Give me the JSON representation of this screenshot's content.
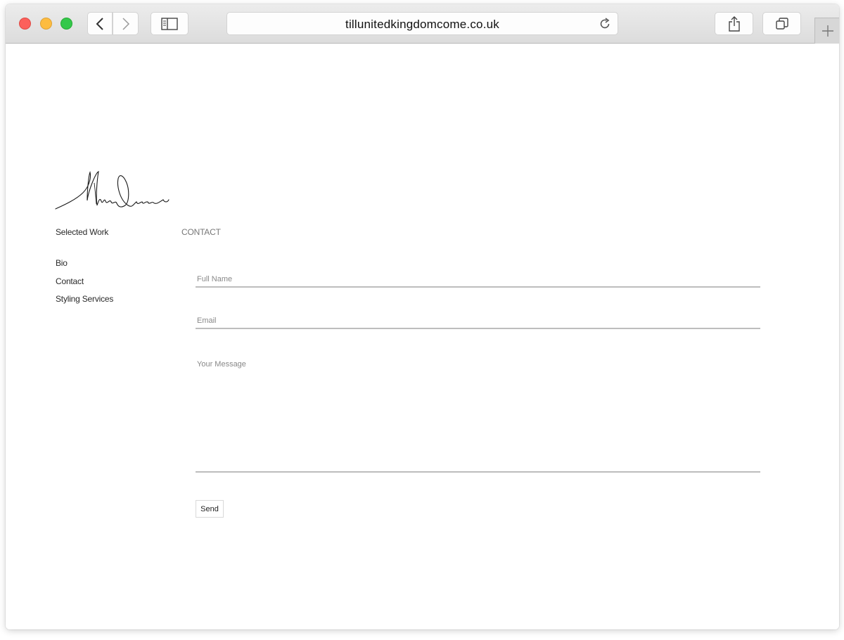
{
  "browser": {
    "url": "tillunitedkingdomcome.co.uk"
  },
  "nav": {
    "selected_work": "Selected Work",
    "contact_title": "CONTACT",
    "items": [
      "Bio",
      "Contact",
      "Styling Services"
    ]
  },
  "form": {
    "full_name_placeholder": "Full Name",
    "email_placeholder": "Email",
    "message_placeholder": "Your Message",
    "send_label": "Send"
  }
}
